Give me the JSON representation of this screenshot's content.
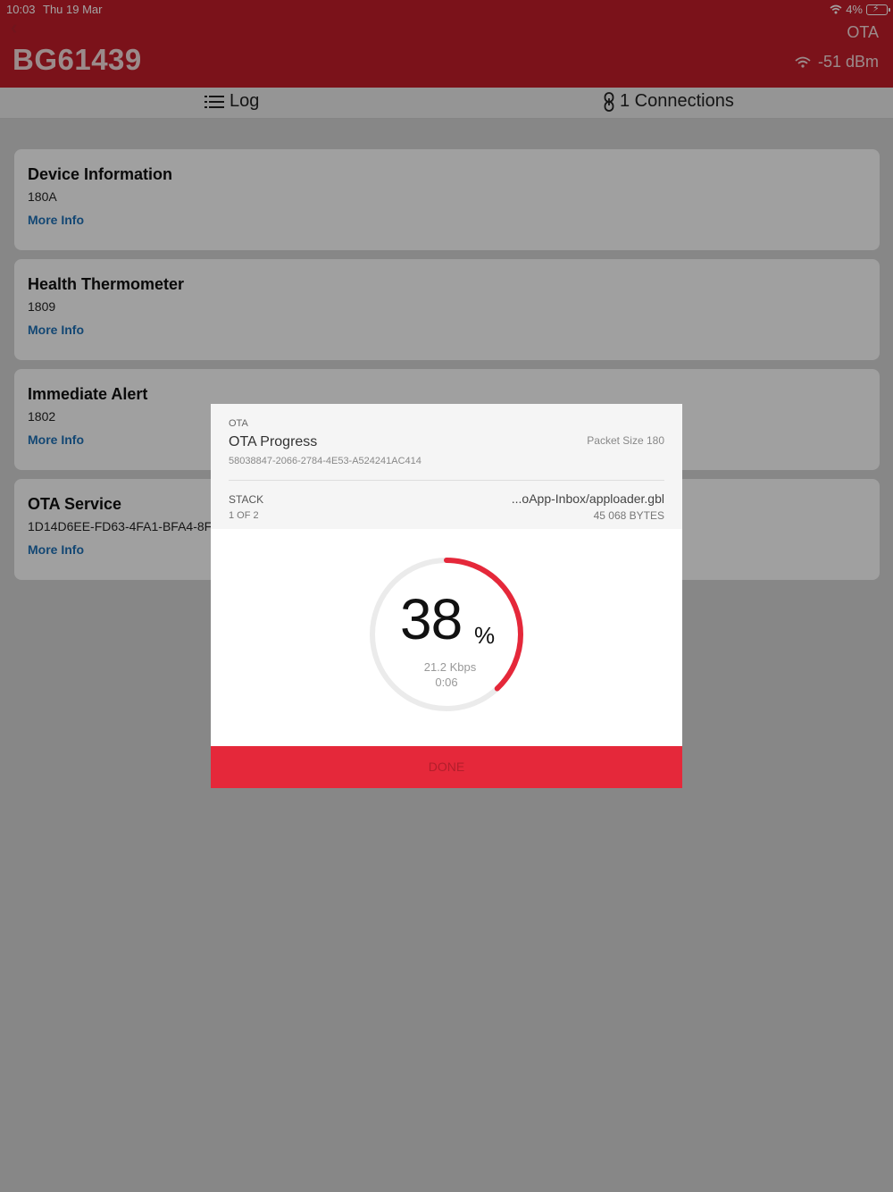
{
  "status_bar": {
    "time": "10:03",
    "date": "Thu 19 Mar",
    "battery": "4%"
  },
  "header": {
    "back_icon": "chevron-left-icon",
    "action_label": "OTA",
    "device_name": "BG61439",
    "rssi": "-51 dBm"
  },
  "tabs": {
    "log": "Log",
    "connections": "1 Connections"
  },
  "services": [
    {
      "name": "Device Information",
      "uuid": "180A",
      "more": "More Info"
    },
    {
      "name": "Health Thermometer",
      "uuid": "1809",
      "more": "More Info"
    },
    {
      "name": "Immediate Alert",
      "uuid": "1802",
      "more": "More Info"
    },
    {
      "name": "OTA Service",
      "uuid": "1D14D6EE-FD63-4FA1-BFA4-8F47",
      "more": "More Info"
    }
  ],
  "dialog": {
    "overline": "OTA",
    "title": "OTA Progress",
    "packet_size": "Packet Size 180",
    "device_uuid": "58038847-2066-2784-4E53-A524241AC414",
    "stack_label": "STACK",
    "file_name": "...oApp-Inbox/apploader.gbl",
    "file_index": "1 OF 2",
    "file_size": "45 068  BYTES",
    "progress_fraction": 0.38,
    "percent": "38",
    "percent_sign": "%",
    "speed": "21.2  Kbps",
    "elapsed": "0:06",
    "done_label": "DONE"
  },
  "colors": {
    "brand": "#c11d2a",
    "progress": "#e5283a",
    "link": "#1e6fb5"
  }
}
